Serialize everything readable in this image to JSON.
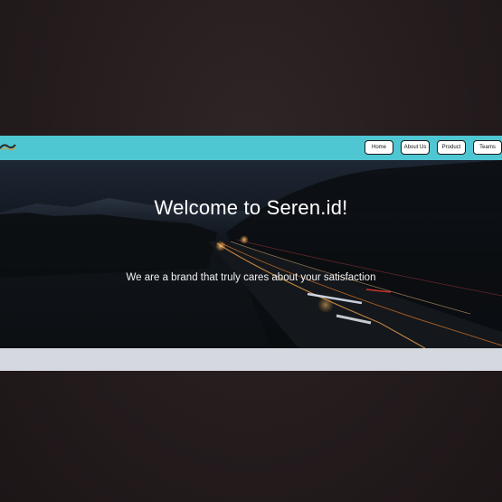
{
  "nav": {
    "logo_icon": "brand-logo-icon",
    "items": [
      {
        "label": "Home"
      },
      {
        "label": "About Us"
      },
      {
        "label": "Product"
      },
      {
        "label": "Teams"
      }
    ],
    "bar_color": "#4ec7d2"
  },
  "hero": {
    "title": "Welcome to Seren.id!",
    "subtitle": "We are a brand that truly cares about your satisfaction",
    "background": "night highway with light trails"
  },
  "colors": {
    "page_background": "#231b1c",
    "footer_strip": "#d5d8de"
  }
}
